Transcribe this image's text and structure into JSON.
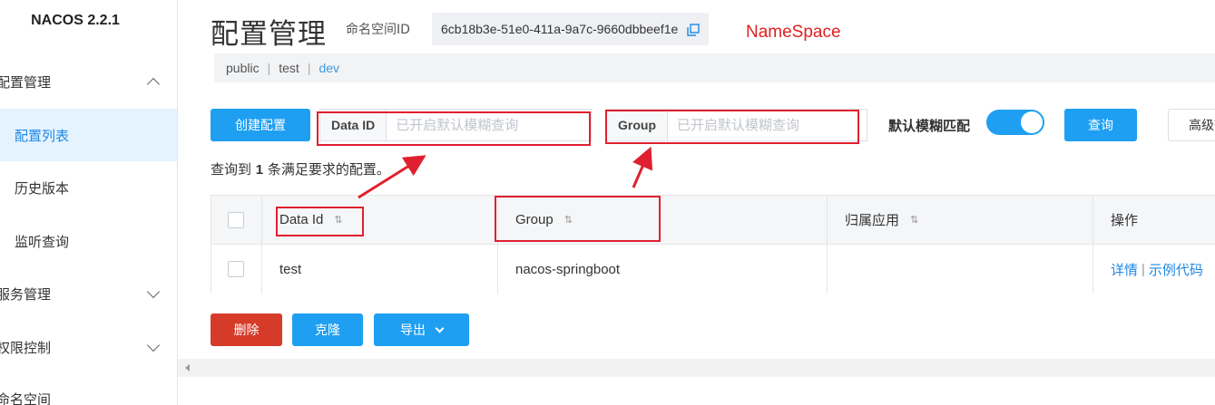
{
  "app": {
    "logo": "NACOS 2.2.1"
  },
  "sidebar": {
    "items": [
      {
        "label": "配置管理",
        "type": "group",
        "expanded": true
      },
      {
        "label": "配置列表",
        "type": "sub",
        "active": true
      },
      {
        "label": "历史版本",
        "type": "sub"
      },
      {
        "label": "监听查询",
        "type": "sub"
      },
      {
        "label": "服务管理",
        "type": "group",
        "expanded": false
      },
      {
        "label": "权限控制",
        "type": "group",
        "expanded": false
      },
      {
        "label": "命名空间",
        "type": "group"
      }
    ]
  },
  "header": {
    "title": "配置管理",
    "namespace_label": "命名空间ID",
    "namespace_id": "6cb18b3e-51e0-411a-9a7c-9660dbbeef1e",
    "annotation": "NameSpace"
  },
  "namespaces": [
    "public",
    "test",
    "dev"
  ],
  "active_namespace": "dev",
  "toolbar": {
    "create_label": "创建配置",
    "dataid_label": "Data ID",
    "dataid_placeholder": "已开启默认模糊查询",
    "group_label": "Group",
    "group_placeholder": "已开启默认模糊查询",
    "fuzzy_label": "默认模糊匹配",
    "fuzzy_on": true,
    "query_label": "查询",
    "advanced_label": "高级查询"
  },
  "result": {
    "prefix": "查询到",
    "count": "1",
    "suffix": "条满足要求的配置。"
  },
  "table": {
    "columns": [
      "Data Id",
      "Group",
      "归属应用",
      "操作"
    ],
    "rows": [
      {
        "data_id": "test",
        "group": "nacos-springboot",
        "app": "",
        "actions": [
          "详情",
          "示例代码"
        ]
      }
    ]
  },
  "bulk": {
    "delete_label": "删除",
    "clone_label": "克隆",
    "export_label": "导出"
  },
  "colors": {
    "primary": "#1e9ff2",
    "danger": "#d63b2a",
    "annotation": "#e02030"
  }
}
